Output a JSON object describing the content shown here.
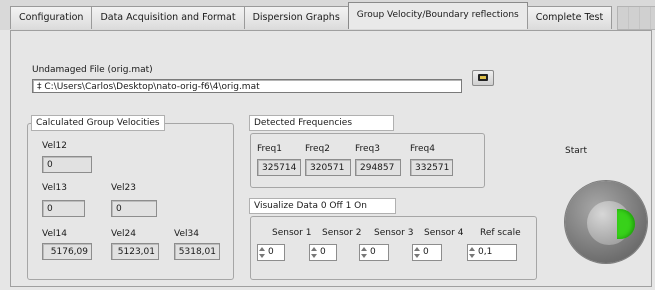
{
  "tabs": [
    {
      "label": "Configuration",
      "active": false
    },
    {
      "label": "Data Acquisition and Format",
      "active": false
    },
    {
      "label": "Dispersion Graphs",
      "active": false
    },
    {
      "label": "Group Velocity/Boundary reflections",
      "active": true
    },
    {
      "label": "Complete Test",
      "active": false
    }
  ],
  "file": {
    "label": "Undamaged File (orig.mat)",
    "path_prefix": "‡",
    "path": "C:\\Users\\Carlos\\Desktop\\nato-orig-f6\\4\\orig.mat",
    "browse_icon": "folder-icon"
  },
  "velocities": {
    "title": "Calculated Group Velocities",
    "vel12": {
      "label": "Vel12",
      "value": "0"
    },
    "vel13": {
      "label": "Vel13",
      "value": "0"
    },
    "vel23": {
      "label": "Vel23",
      "value": "0"
    },
    "vel14": {
      "label": "Vel14",
      "value": "5176,09"
    },
    "vel24": {
      "label": "Vel24",
      "value": "5123,01"
    },
    "vel34": {
      "label": "Vel34",
      "value": "5318,01"
    }
  },
  "frequencies": {
    "title": "Detected Frequencies",
    "items": [
      {
        "label": "Freq1",
        "value": "325714"
      },
      {
        "label": "Freq2",
        "value": "320571"
      },
      {
        "label": "Freq3",
        "value": "294857"
      },
      {
        "label": "Freq4",
        "value": "332571"
      }
    ]
  },
  "visualize": {
    "title": "Visualize Data 0 Off 1 On",
    "items": [
      {
        "label": "Sensor 1",
        "value": "0"
      },
      {
        "label": "Sensor 2",
        "value": "0"
      },
      {
        "label": "Sensor 3",
        "value": "0"
      },
      {
        "label": "Sensor 4",
        "value": "0"
      },
      {
        "label": "Ref scale",
        "value": "0,1"
      }
    ]
  },
  "start": {
    "label": "Start",
    "icon": "play-arrow-icon",
    "color": "#38d11a"
  }
}
